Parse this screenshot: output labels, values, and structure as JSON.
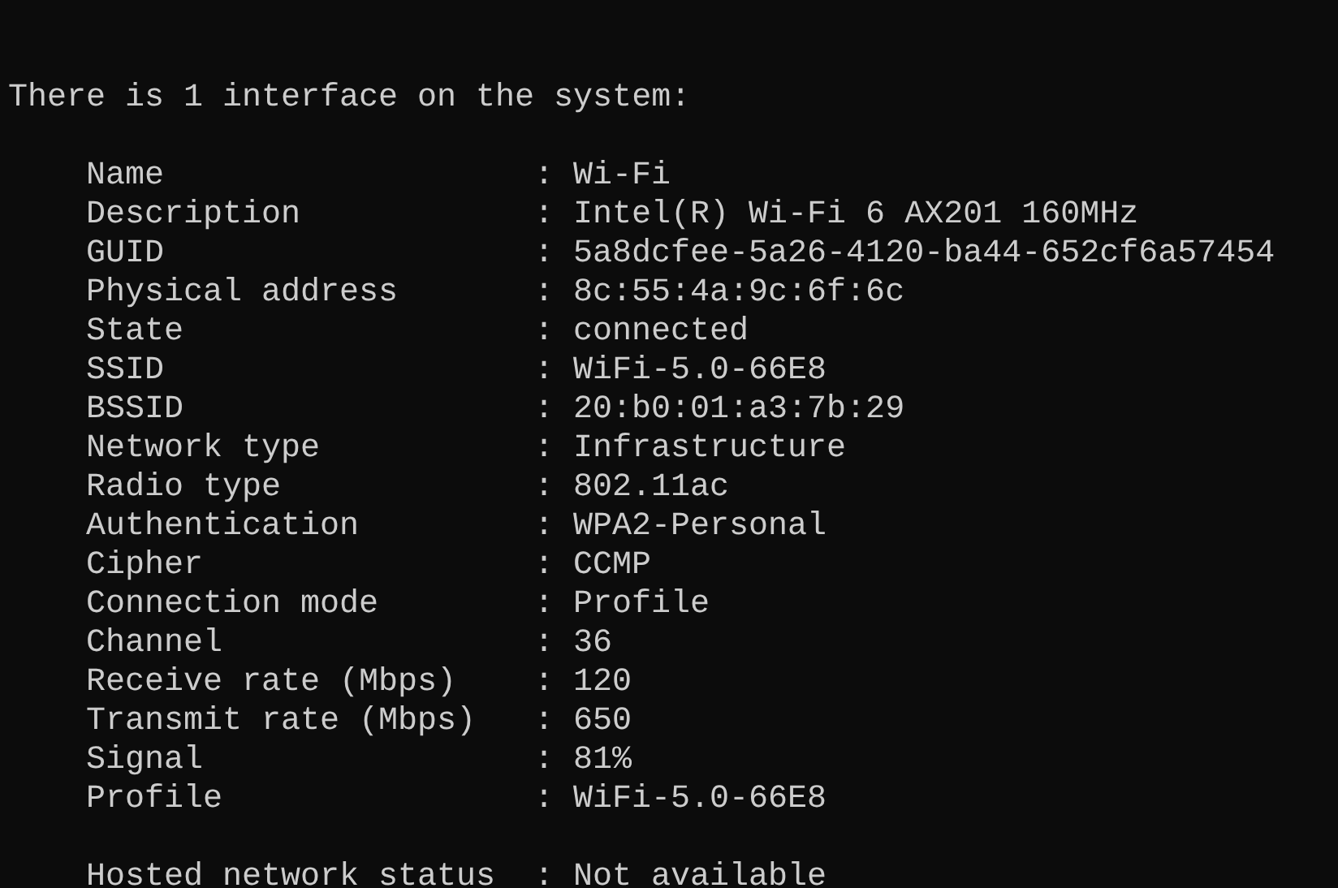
{
  "header": "There is 1 interface on the system:",
  "fields": [
    {
      "label": "Name",
      "separator": ":",
      "value": "Wi-Fi"
    },
    {
      "label": "Description",
      "separator": ":",
      "value": "Intel(R) Wi-Fi 6 AX201 160MHz"
    },
    {
      "label": "GUID",
      "separator": ":",
      "value": "5a8dcfee-5a26-4120-ba44-652cf6a57454"
    },
    {
      "label": "Physical address",
      "separator": ":",
      "value": "8c:55:4a:9c:6f:6c"
    },
    {
      "label": "State",
      "separator": ":",
      "value": "connected"
    },
    {
      "label": "SSID",
      "separator": ":",
      "value": "WiFi-5.0-66E8"
    },
    {
      "label": "BSSID",
      "separator": ":",
      "value": "20:b0:01:a3:7b:29"
    },
    {
      "label": "Network type",
      "separator": ":",
      "value": "Infrastructure"
    },
    {
      "label": "Radio type",
      "separator": ":",
      "value": "802.11ac"
    },
    {
      "label": "Authentication",
      "separator": ":",
      "value": "WPA2-Personal"
    },
    {
      "label": "Cipher",
      "separator": ":",
      "value": "CCMP"
    },
    {
      "label": "Connection mode",
      "separator": ":",
      "value": "Profile"
    },
    {
      "label": "Channel",
      "separator": ":",
      "value": "36"
    },
    {
      "label": "Receive rate (Mbps)",
      "separator": ":",
      "value": "120"
    },
    {
      "label": "Transmit rate (Mbps)",
      "separator": ":",
      "value": "650"
    },
    {
      "label": "Signal",
      "separator": ":",
      "value": "81%"
    },
    {
      "label": "Profile",
      "separator": ":",
      "value": "WiFi-5.0-66E8"
    }
  ],
  "hosted": [
    {
      "label": "Hosted network status",
      "separator": ":",
      "value": "Not available"
    }
  ]
}
